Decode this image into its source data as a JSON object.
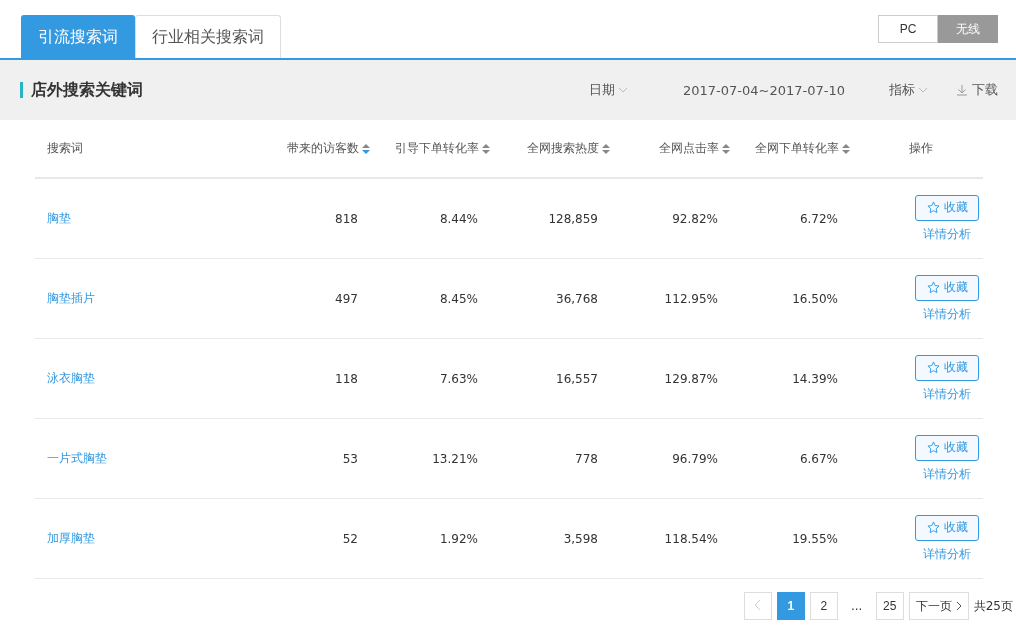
{
  "tabs": [
    {
      "label": "引流搜索词",
      "selected": true
    },
    {
      "label": "行业相关搜索词",
      "selected": false
    }
  ],
  "device_switch": [
    {
      "label": "PC",
      "selected": false
    },
    {
      "label": "无线",
      "selected": true
    }
  ],
  "panel": {
    "title": "店外搜索关键词",
    "date_label": "日期",
    "date_range": "2017-07-04~2017-07-10",
    "metric_label": "指标",
    "download_label": "下载"
  },
  "table": {
    "columns": [
      {
        "label": "搜索词",
        "kind": "plain"
      },
      {
        "label": "带来的访客数",
        "kind": "sortable",
        "sorted": true
      },
      {
        "label": "引导下单转化率",
        "kind": "sortable",
        "sorted": false
      },
      {
        "label": "全网搜索热度",
        "kind": "sortable",
        "sorted": false
      },
      {
        "label": "全网点击率",
        "kind": "sortable",
        "sorted": false
      },
      {
        "label": "全网下单转化率",
        "kind": "sortable",
        "sorted": false
      },
      {
        "label": "操作",
        "kind": "plain"
      }
    ],
    "rows": [
      {
        "keyword": "胸垫",
        "visitors": "818",
        "order_rate": "8.44%",
        "search_heat": "128,859",
        "click_rate": "92.82%",
        "net_order_rate": "6.72%",
        "favorite_label": "收藏",
        "detail_label": "详情分析"
      },
      {
        "keyword": "胸垫插片",
        "visitors": "497",
        "order_rate": "8.45%",
        "search_heat": "36,768",
        "click_rate": "112.95%",
        "net_order_rate": "16.50%",
        "favorite_label": "收藏",
        "detail_label": "详情分析"
      },
      {
        "keyword": "泳衣胸垫",
        "visitors": "118",
        "order_rate": "7.63%",
        "search_heat": "16,557",
        "click_rate": "129.87%",
        "net_order_rate": "14.39%",
        "favorite_label": "收藏",
        "detail_label": "详情分析"
      },
      {
        "keyword": "一片式胸垫",
        "visitors": "53",
        "order_rate": "13.21%",
        "search_heat": "778",
        "click_rate": "96.79%",
        "net_order_rate": "6.67%",
        "favorite_label": "收藏",
        "detail_label": "详情分析"
      },
      {
        "keyword": "加厚胸垫",
        "visitors": "52",
        "order_rate": "1.92%",
        "search_heat": "3,598",
        "click_rate": "118.54%",
        "net_order_rate": "19.55%",
        "favorite_label": "收藏",
        "detail_label": "详情分析"
      }
    ]
  },
  "pagination": {
    "prev_disabled": true,
    "pages": [
      {
        "label": "1",
        "kind": "page",
        "selected": true
      },
      {
        "label": "2",
        "kind": "page",
        "selected": false
      },
      {
        "label": "...",
        "kind": "ellipsis"
      },
      {
        "label": "25",
        "kind": "page",
        "selected": false
      }
    ],
    "next_label": "下一页",
    "total": "共25页"
  }
}
